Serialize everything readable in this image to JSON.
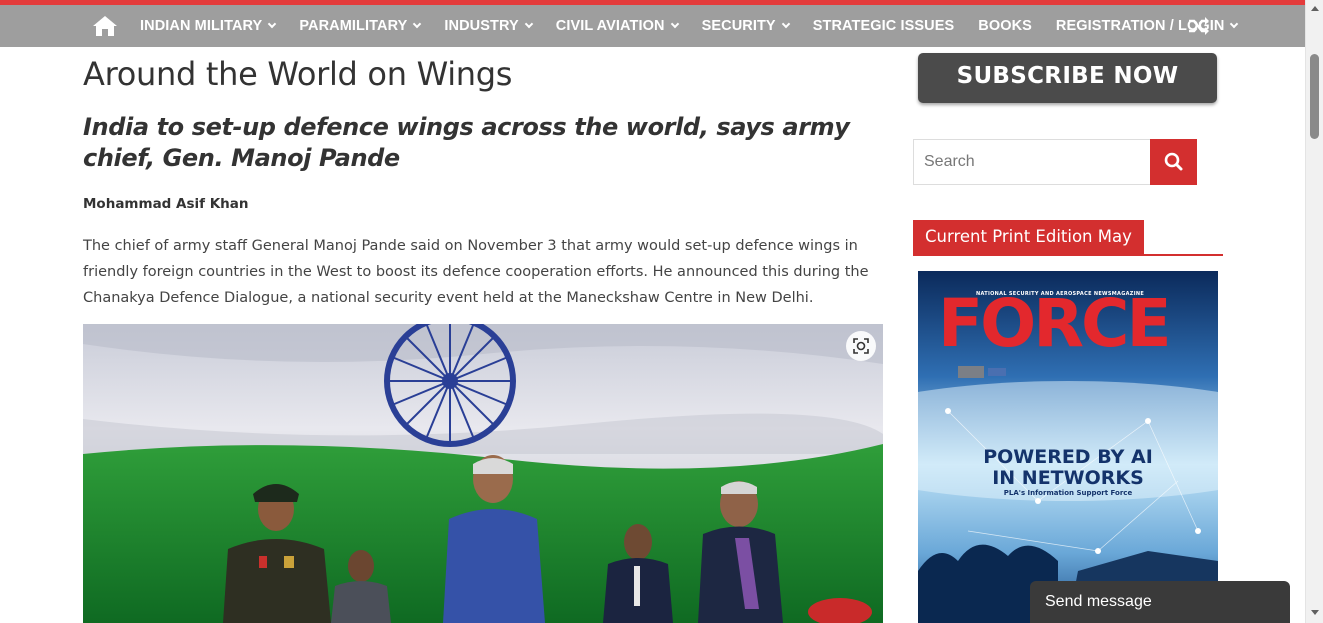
{
  "nav": {
    "home_icon": "home-icon",
    "items": [
      {
        "label": "INDIAN MILITARY",
        "dropdown": true
      },
      {
        "label": "PARAMILITARY",
        "dropdown": true
      },
      {
        "label": "INDUSTRY",
        "dropdown": true
      },
      {
        "label": "CIVIL AVIATION",
        "dropdown": true
      },
      {
        "label": "SECURITY",
        "dropdown": true
      },
      {
        "label": "STRATEGIC ISSUES",
        "dropdown": false
      },
      {
        "label": "BOOKS",
        "dropdown": false
      },
      {
        "label": "REGISTRATION / LOGIN",
        "dropdown": true
      }
    ],
    "shuffle_icon": "shuffle-icon",
    "bar_color": "#9e9e9e",
    "accent_color": "#e43b3b"
  },
  "article": {
    "title": "Around the World on Wings",
    "subtitle": "India to set-up defence wings across the world, says army chief, Gen. Manoj Pande",
    "author": "Mohammad Asif Khan",
    "body": "The chief of army staff General Manoj Pande said on November 3 that army would set-up defence wings in friendly foreign countries in the West to boost its defence cooperation efforts. He announced this during the Chanakya Defence Dialogue, a national security event held at the Maneckshaw Centre in New Delhi.",
    "image_icon": "visual-search-icon"
  },
  "sidebar": {
    "subscribe_label": "SUBSCRIBE NOW",
    "search_placeholder": "Search",
    "search_icon": "search-icon",
    "edition_label": "Current Print Edition May",
    "cover": {
      "masthead": "FORCE",
      "tagline": "NATIONAL SECURITY AND AEROSPACE NEWSMAGAZINE",
      "headline_line1": "POWERED BY AI",
      "headline_line2": "IN NETWORKS",
      "subline": "PLA's Information Support Force"
    },
    "accent_color": "#d32f2f"
  },
  "chat": {
    "label": "Send message"
  }
}
